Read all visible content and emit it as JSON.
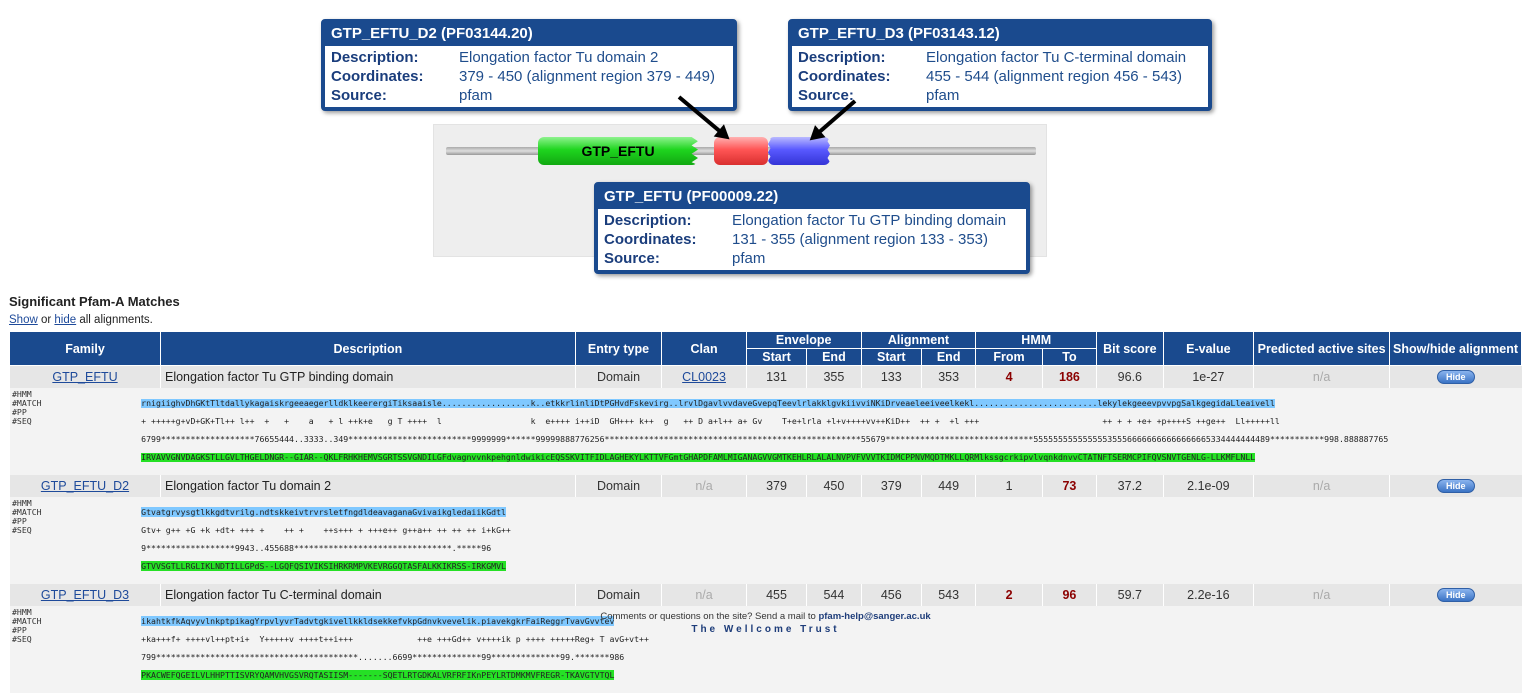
{
  "tooltips": {
    "d2": {
      "title": "GTP_EFTU_D2 (PF03144.20)",
      "description_label": "Description:",
      "description": "Elongation factor Tu domain 2",
      "coords_label": "Coordinates:",
      "coords": "379 - 450 (alignment region 379 - 449)",
      "source_label": "Source:",
      "source": "pfam"
    },
    "d3": {
      "title": "GTP_EFTU_D3 (PF03143.12)",
      "description_label": "Description:",
      "description": "Elongation factor Tu C-terminal domain",
      "coords_label": "Coordinates:",
      "coords": "455 - 544 (alignment region 456 - 543)",
      "source_label": "Source:",
      "source": "pfam"
    },
    "eftu": {
      "title": "GTP_EFTU (PF00009.22)",
      "description_label": "Description:",
      "description": "Elongation factor Tu GTP binding domain",
      "coords_label": "Coordinates:",
      "coords": "131 - 355 (alignment region 133 - 353)",
      "source_label": "Source:",
      "source": "pfam"
    }
  },
  "graphic": {
    "domain_label": "GTP_EFTU"
  },
  "section": {
    "title": "Significant Pfam-A Matches",
    "show": "Show",
    "or": " or ",
    "hide": "hide",
    "rest": " all alignments."
  },
  "headers": {
    "family": "Family",
    "description": "Description",
    "entry_type": "Entry type",
    "clan": "Clan",
    "envelope": "Envelope",
    "alignment": "Alignment",
    "hmm": "HMM",
    "bit_score": "Bit score",
    "evalue": "E-value",
    "active_sites": "Predicted active sites",
    "show_hide": "Show/hide alignment",
    "start": "Start",
    "end": "End",
    "from": "From",
    "to": "To"
  },
  "rows": [
    {
      "family": "GTP_EFTU",
      "description": "Elongation factor Tu GTP binding domain",
      "entry_type": "Domain",
      "clan": "CL0023",
      "env_start": "131",
      "env_end": "355",
      "aln_start": "133",
      "aln_end": "353",
      "hmm_from": "4",
      "hmm_to": "186",
      "bit_score": "96.6",
      "evalue": "1e-27",
      "active_sites": "n/a",
      "button": "Hide"
    },
    {
      "family": "GTP_EFTU_D2",
      "description": "Elongation factor Tu domain 2",
      "entry_type": "Domain",
      "clan": "n/a",
      "env_start": "379",
      "env_end": "450",
      "aln_start": "379",
      "aln_end": "449",
      "hmm_from": "1",
      "hmm_to": "73",
      "bit_score": "37.2",
      "evalue": "2.1e-09",
      "active_sites": "n/a",
      "button": "Hide"
    },
    {
      "family": "GTP_EFTU_D3",
      "description": "Elongation factor Tu C-terminal domain",
      "entry_type": "Domain",
      "clan": "n/a",
      "env_start": "455",
      "env_end": "544",
      "aln_start": "456",
      "aln_end": "543",
      "hmm_from": "2",
      "hmm_to": "96",
      "bit_score": "59.7",
      "evalue": "2.2e-16",
      "active_sites": "n/a",
      "button": "Hide"
    }
  ],
  "alignment_labels": [
    "#HMM",
    "#MATCH",
    "#PP",
    "#SEQ"
  ],
  "alignments": [
    {
      "hmm": "rnigiighvDhGKtTltdallykagaiskrgeeaegerlldklkeerergiTiksaaisle..................k..etkkrlinliDtPGHvdFskevirg..lrvlDgavlvvdaveGvepqTeevlrlakklgvkiivviNKiDrveaeleeiveelkekl.........................lekylekgeeevpvvpgSalkgegidaLleaivell",
      "match": "+ +++++g+vD+GK+Tl++ l++  +   +    a   + l ++k+e   g T ++++  l                  k  e++++ i++iD  GH+++ k++  g   ++ D a+l++ a+ Gv    T+e+lrla +l+v++++vv++KiD++  ++ +  +l +++                         ++ + + +e+ +p++++S ++ge++  Ll+++++ll",
      "pp": "6799*******************76655444..3333..349*************************9999999******99999888776256****************************************************55679******************************555555555555555355566666666666666665334444444489***********998.888887765",
      "seq": "IRVAVVGNVDAGKSTLLGVLTHGELDNGR--GIAR--QKLFRHKHEMVSGRTSSVGNDILGFdvagnvvnkpehgnldwikicEQSSKVITFIDLAGHEKYLKTTVFGmtGHAPDFAMLMIGANAGVVGMTKEHLRLALALNVPVFVVVTKIDMCPPNVMQDTMKLLQRMlkssgcrkipvlvqnkdnvvCTATNFTSERMCPIFQVSNVTGENLG-LLKMFLNLL"
    },
    {
      "hmm": "Gtvatgrvysgtlkkgdtvrilg.ndtskkeivtrvrsletfngdldeavaganaGvivaikgledaiikGdtl",
      "match": "Gtv+ g++ +G +k +dt+ +++ +    ++ +    ++s+++ + +++e++ g++a++ ++ ++ ++ i+kG++",
      "pp": "9******************9943..455688********************************.*****96",
      "seq": "GTVVSGTLLRGLIKLNDTILLGPdS--LGQFQSIVIKSIHRKRMPVKEVRGGQTASFALKKIKRSS-IRKGMVL"
    },
    {
      "hmm": "ikahtkfkAqvyvlnkptpikagYrpvlyvrTadvtgkivellkkldsekkefvkpGdnvkvevelik.piavekgkrFaiReggrTvavGvvtev",
      "match": "+ka+++f+ ++++vl++pt+i+  Y+++++v ++++t++i+++             ++e +++Gd++ v++++ik p ++++ +++++Reg+ T avG+vt++",
      "pp": "799*****************************************.......6699**************99**************99.*******986",
      "seq": "PKACWEFQGEILVLHHPTTISVRYQAMVHVGSVRQTASIISM-------SQETLRTGDKALVRFRFIKnPEYLRTDMKMVFREGR-TKAVGTVTQL"
    }
  ],
  "footer": {
    "line1_pre": "Comments or questions on the site? Send a mail to ",
    "email": "pfam-help@sanger.ac.uk",
    "line2": "The Wellcome Trust"
  }
}
